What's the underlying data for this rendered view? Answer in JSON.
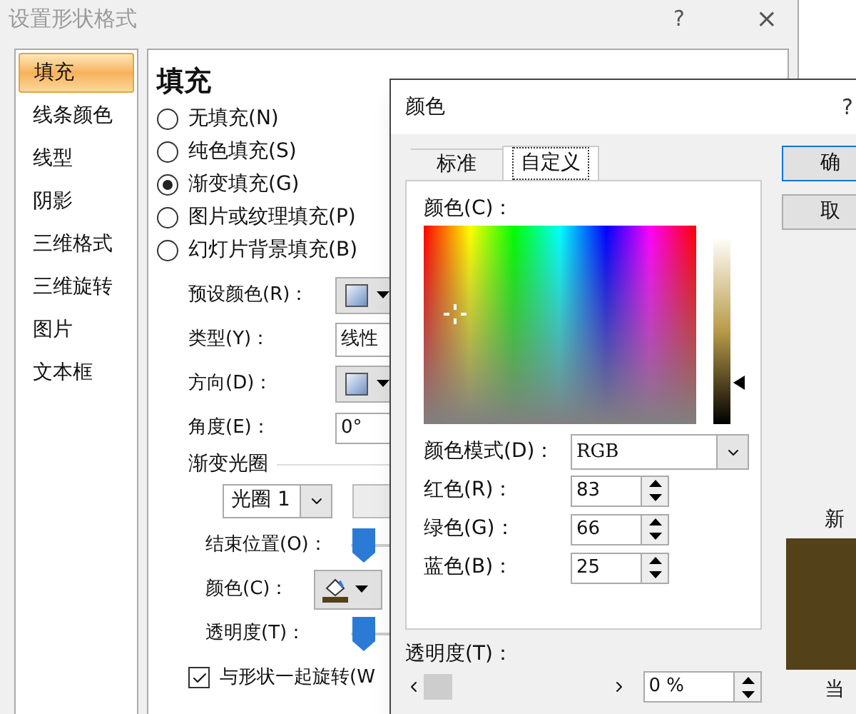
{
  "format_dialog": {
    "title": "设置形状格式",
    "help": "?",
    "close": "×"
  },
  "sidebar": {
    "items": [
      {
        "label": "填充",
        "selected": true
      },
      {
        "label": "线条颜色",
        "selected": false
      },
      {
        "label": "线型",
        "selected": false
      },
      {
        "label": "阴影",
        "selected": false
      },
      {
        "label": "三维格式",
        "selected": false
      },
      {
        "label": "三维旋转",
        "selected": false
      },
      {
        "label": "图片",
        "selected": false
      },
      {
        "label": "文本框",
        "selected": false
      }
    ]
  },
  "fill": {
    "heading": "填充",
    "options": [
      {
        "label": "无填充(N)",
        "selected": false
      },
      {
        "label": "纯色填充(S)",
        "selected": false
      },
      {
        "label": "渐变填充(G)",
        "selected": true
      },
      {
        "label": "图片或纹理填充(P)",
        "selected": false
      },
      {
        "label": "幻灯片背景填充(B)",
        "selected": false
      }
    ],
    "preset": {
      "label": "预设颜色(R)："
    },
    "type": {
      "label": "类型(Y)：",
      "value": "线性"
    },
    "direction": {
      "label": "方向(D)："
    },
    "angle": {
      "label": "角度(E)：",
      "value": "0°"
    },
    "stops_heading": "渐变光圈",
    "stop_select": {
      "value": "光圈 1"
    },
    "end_position": {
      "label": "结束位置(O)：",
      "level": 0
    },
    "color": {
      "label": "颜色(C)："
    },
    "transparency": {
      "label": "透明度(T)：",
      "level": 0
    },
    "rotate": {
      "label": "与形状一起旋转(W",
      "checked": true
    }
  },
  "color_dialog": {
    "title": "颜色",
    "help": "?",
    "tabs": [
      {
        "label": "标准",
        "selected": false
      },
      {
        "label": "自定义",
        "selected": true
      }
    ],
    "color_label": "颜色(C)：",
    "mode": {
      "label": "颜色模式(D)：",
      "value": "RGB"
    },
    "channels": [
      {
        "label": "红色(R)：",
        "value": "83"
      },
      {
        "label": "绿色(G)：",
        "value": "66"
      },
      {
        "label": "蓝色(B)：",
        "value": "25"
      }
    ],
    "transparency": {
      "label": "透明度(T)：",
      "value": "0 %"
    },
    "buttons": [
      "确",
      "取"
    ],
    "new_label": "新",
    "current_label": "当"
  }
}
